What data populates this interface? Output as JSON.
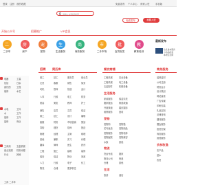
{
  "topbar": {
    "items": [
      "登录",
      "注册",
      "我的收藏",
      "免费发布",
      "个人中心",
      "商家入驻",
      "手机版"
    ]
  },
  "search": {
    "placeholder": "请输入关键词搜索",
    "post_label": "免费发布",
    "login_label": "我要入驻"
  },
  "nav": {
    "city": "开始公众号",
    "promo": "招募推广",
    "vip": "VIP会员"
  },
  "categories": [
    {
      "icon": "二",
      "label": "二手车",
      "color": "#f5a623"
    },
    {
      "icon": "房",
      "label": "房产",
      "color": "#f05a5a"
    },
    {
      "icon": "宠",
      "label": "宠物",
      "color": "#f07d3c"
    },
    {
      "icon": "生",
      "label": "生活服务",
      "color": "#3aa0e6"
    },
    {
      "icon": "商",
      "label": "商务服务",
      "color": "#36b37e"
    },
    {
      "icon": "市",
      "label": "二手市场",
      "color": "#f5a623"
    },
    {
      "icon": "批",
      "label": "百货批发",
      "color": "#f05a5a"
    },
    {
      "icon": "教",
      "label": "教育培训",
      "color": "#e04a8a"
    }
  ],
  "latest": {
    "title": "最新发布",
    "lines": [
      "信息发布服务",
      "小商品批发",
      "本地信息网"
    ]
  },
  "left_panel": {
    "rows": [
      [
        "电器",
        "工装"
      ],
      [
        "包括",
        "日杂"
      ],
      [
        "我们的",
        "工程"
      ],
      [
        "装修",
        "木艺"
      ],
      [
        "",
        ""
      ],
      [
        "水电",
        "工料"
      ],
      [
        "水",
        "工作"
      ],
      [
        "装修",
        "工作"
      ],
      [
        "装修",
        "商业"
      ],
      [
        "工商用",
        "五金机械"
      ],
      [
        "营业执照",
        "财务代理"
      ],
      [
        "行业",
        "其他"
      ]
    ],
    "footer": "工具 二手车"
  },
  "recruit": {
    "title": "招聘",
    "title2": "简历库",
    "rows": [
      [
        "普工",
        "技工",
        "服务员",
        "营业员"
      ],
      [
        "文员",
        "客服",
        "销售",
        "保安"
      ],
      [
        "司机",
        "厨师",
        "快递",
        "会计"
      ],
      [
        "",
        "",
        "",
        ""
      ],
      [
        "人事",
        "行政",
        "电工",
        "财务"
      ],
      [
        "美容",
        "美发",
        "教师",
        "护士"
      ],
      [
        "",
        "",
        "",
        ""
      ],
      [
        "销售",
        "店员",
        "文员",
        "保洁"
      ],
      [
        "普工",
        "技工",
        "设计",
        "编辑"
      ],
      [
        "客服",
        "财务",
        "市场营销",
        "策划"
      ],
      [
        "导购",
        "理货",
        "厨师",
        "配送"
      ],
      [
        "管理",
        "经理",
        "主管",
        "助理"
      ],
      [
        "其他",
        "兼职",
        "实习",
        "代理"
      ],
      [
        "翻译",
        "律师",
        "医生",
        "药剂"
      ],
      [
        "工程",
        "施工",
        "建筑",
        "装修"
      ],
      [
        "保安",
        "保洁",
        "物业",
        "家政"
      ],
      [
        "人力",
        "行政",
        "电子",
        "化工"
      ],
      [
        "物流",
        "仓储",
        "更多职位",
        ""
      ]
    ]
  },
  "food": {
    "title": "餐饮商铺",
    "rows": [
      [
        "工程机械",
        "农业设备"
      ],
      [
        "工程机械",
        "电工设备"
      ],
      [
        "五金配件",
        "机械设备"
      ]
    ],
    "title2": "生活服务",
    "rows2": [
      [
        "家政服务",
        "保洁清洗"
      ],
      [
        "搬家搬运",
        "管道疏通"
      ],
      [
        "开锁换锁",
        "婚庆摄影"
      ],
      [
        "维修服务",
        "回收"
      ]
    ],
    "title3": "宠物",
    "rows3": [
      [
        "宠物狗",
        "宠物猫"
      ],
      [
        "花鸟鱼虫",
        "宠物用品"
      ],
      [
        "宠物服务",
        "宠物领养"
      ],
      [
        "宠物医院",
        "宠物美容"
      ],
      [
        "水族",
        "其他"
      ]
    ],
    "title4": "物流",
    "rows4": [
      [
        "货运专线",
        "搬家"
      ],
      [
        "物流公司",
        "快递"
      ],
      [
        "仓储",
        "其他"
      ]
    ],
    "title5": "生活",
    "rows5": [
      [
        "旅游",
        "酒店"
      ]
    ]
  },
  "business": {
    "title": "商务服务",
    "rows": [
      [
        "装修建材"
      ],
      [
        "公司注册"
      ],
      [
        "财务会计"
      ],
      [
        "设计策划"
      ],
      [
        "网站建设"
      ],
      [
        "广告传媒"
      ],
      [
        "印刷包装"
      ],
      [
        "礼品定制"
      ],
      [
        "法律咨询"
      ],
      [
        "翻译服务"
      ],
      [
        "展会服务"
      ],
      [
        "投资担保"
      ],
      [
        "商务服务"
      ],
      [
        "其他服务"
      ]
    ],
    "title2": "农林牧渔",
    "rows2": [
      [
        "农产品"
      ],
      [
        "苗木"
      ],
      [
        "农资"
      ]
    ]
  }
}
